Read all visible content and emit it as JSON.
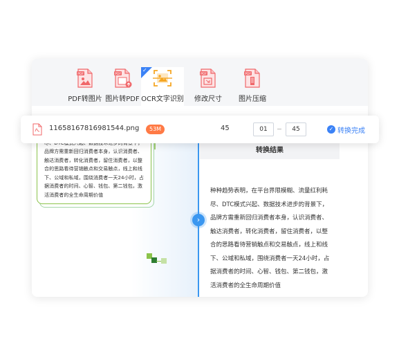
{
  "toolbar": {
    "items": [
      {
        "label": "PDF转图片",
        "icon": "pdf-to-image-icon"
      },
      {
        "label": "图片转PDF",
        "icon": "image-to-pdf-icon"
      },
      {
        "label": "OCR文字识别",
        "icon": "ocr-icon",
        "active": true
      },
      {
        "label": "修改尺寸",
        "icon": "resize-icon"
      },
      {
        "label": "图片压缩",
        "icon": "compress-icon"
      }
    ],
    "icon_tag": "PDF"
  },
  "file": {
    "name": "11658167816981544.png",
    "size": "53M",
    "page_count": "45",
    "page_from": "01",
    "page_to": "45",
    "status": "转换完成"
  },
  "source_text": "种种趋势表明，在平台界限模糊、流量红利耗尽、DTC模式兴起、数据技术进步的背景下，品牌方需重新回归消费者本身，认识消费者、触达消费者，转化消费者，留住消费者，以整合的思路看待营销触点和交易触点，线上和线下、公域和私域，围绕消费者一天24小时，占据消费者的时间、心智、钱包、第二钱包，激活消费者的全生命周期价值",
  "result": {
    "title": "转换结果",
    "text": "种种趋势表明，在平台界限模糊、流量红利耗尽、DTC模式兴起、数据技术进步的背景下，品牌方需重新回归消费者本身，认识消费者、触达消费者，转化消费者，留住消费者，以整合的思路看待营销触点和交易触点，线上和线下、公域和私域，围绕消费者一天24小时，占据消费者的时间、心智、钱包、第二钱包，激活消费者的全生命周期价值"
  },
  "colors": {
    "accent": "#3b82f6",
    "pdf_red": "#f0676a",
    "size_badge": "#ff7a45",
    "ocr_orange": "#f5a623",
    "frame_green": "#8bc34a"
  }
}
